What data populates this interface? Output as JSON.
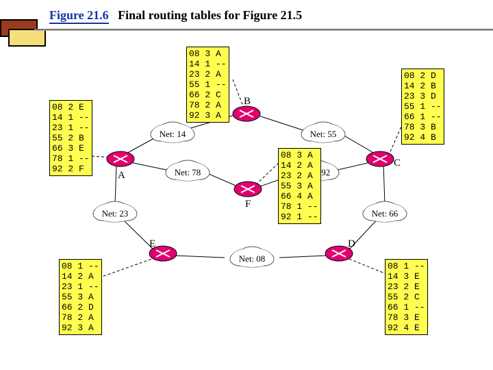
{
  "title": {
    "fig": "Figure 21.6",
    "rest": "Final routing tables for Figure 21.5"
  },
  "nets": {
    "n14": "Net: 14",
    "n55": "Net: 55",
    "n78": "Net: 78",
    "n92": "Net: 92",
    "n23": "Net: 23",
    "n66": "Net: 66",
    "n08": "Net: 08"
  },
  "routers": {
    "A": "A",
    "B": "B",
    "C": "C",
    "D": "D",
    "E": "E",
    "F": "F"
  },
  "tables": {
    "A": "08 2 E\n14 1 --\n23 1 --\n55 2 B\n66 3 E\n78 1 --\n92 2 F",
    "B": "08 3 A\n14 1 --\n23 2 A\n55 1 --\n66 2 C\n78 2 A\n92 3 A",
    "C": "08 2 D\n14 2 B\n23 3 D\n55 1 --\n66 1 --\n78 3 B\n92 4 B",
    "D": "08 1 --\n14 3 E\n23 2 E\n55 2 C\n66 1 --\n78 3 E\n92 4 E",
    "E": "08 1 --\n14 2 A\n23 1 --\n55 3 A\n66 2 D\n78 2 A\n92 3 A",
    "F": "08 3 A\n14 2 A\n23 2 A\n55 3 A\n66 4 A\n78 1 --\n92 1 --"
  }
}
